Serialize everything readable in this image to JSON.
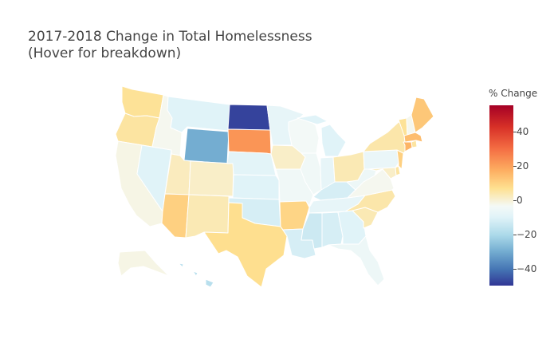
{
  "title": {
    "line1": "2017-2018 Change in Total Homelessness",
    "line2": "(Hover for breakdown)"
  },
  "colorbar": {
    "title": "% Change",
    "ticks": [
      "40",
      "20",
      "0",
      "−20",
      "−40"
    ]
  },
  "colors": {
    "deep_red": "#a50026",
    "orange": "#fdae61",
    "pale_yellow": "#fee090",
    "near_white": "#f4f9f7",
    "light_blue": "#d9eef5",
    "mid_blue": "#74add1",
    "deep_blue": "#313695"
  },
  "map_data": {
    "type": "choropleth",
    "scope": "usa",
    "metric": "% Change",
    "range": [
      -50,
      55
    ],
    "states": [
      {
        "code": "WA",
        "value": 6
      },
      {
        "code": "OR",
        "value": 5
      },
      {
        "code": "CA",
        "value": -2
      },
      {
        "code": "NV",
        "value": -10
      },
      {
        "code": "ID",
        "value": -3
      },
      {
        "code": "MT",
        "value": -10
      },
      {
        "code": "WY",
        "value": -30
      },
      {
        "code": "UT",
        "value": 2
      },
      {
        "code": "AZ",
        "value": 10
      },
      {
        "code": "CO",
        "value": 1
      },
      {
        "code": "NM",
        "value": 3
      },
      {
        "code": "ND",
        "value": -48
      },
      {
        "code": "SD",
        "value": 22
      },
      {
        "code": "NE",
        "value": -9
      },
      {
        "code": "KS",
        "value": -10
      },
      {
        "code": "OK",
        "value": -12
      },
      {
        "code": "TX",
        "value": 7
      },
      {
        "code": "MN",
        "value": -8
      },
      {
        "code": "IA",
        "value": 1
      },
      {
        "code": "MO",
        "value": -5
      },
      {
        "code": "AR",
        "value": 9
      },
      {
        "code": "LA",
        "value": -12
      },
      {
        "code": "WI",
        "value": -4
      },
      {
        "code": "IL",
        "value": -5
      },
      {
        "code": "MI",
        "value": -10
      },
      {
        "code": "IN",
        "value": -8
      },
      {
        "code": "OH",
        "value": 3
      },
      {
        "code": "KY",
        "value": -12
      },
      {
        "code": "TN",
        "value": -8
      },
      {
        "code": "MS",
        "value": -14
      },
      {
        "code": "AL",
        "value": -12
      },
      {
        "code": "GA",
        "value": -10
      },
      {
        "code": "FL",
        "value": -6
      },
      {
        "code": "SC",
        "value": 3
      },
      {
        "code": "NC",
        "value": 4
      },
      {
        "code": "VA",
        "value": -3
      },
      {
        "code": "WV",
        "value": -6
      },
      {
        "code": "PA",
        "value": -7
      },
      {
        "code": "NY",
        "value": 4
      },
      {
        "code": "VT",
        "value": 6
      },
      {
        "code": "NH",
        "value": -3
      },
      {
        "code": "ME",
        "value": 12
      },
      {
        "code": "MA",
        "value": 14
      },
      {
        "code": "CT",
        "value": 16
      },
      {
        "code": "RI",
        "value": 5
      },
      {
        "code": "NJ",
        "value": 10
      },
      {
        "code": "DE",
        "value": 5
      },
      {
        "code": "MD",
        "value": 1
      },
      {
        "code": "AK",
        "value": -2
      },
      {
        "code": "HI",
        "value": -18
      }
    ]
  }
}
